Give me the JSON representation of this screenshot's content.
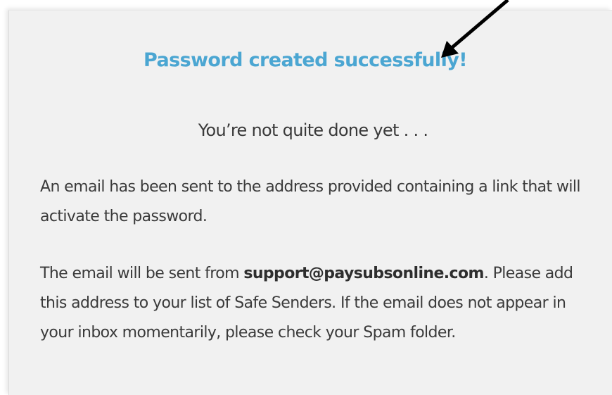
{
  "confirmation": {
    "title": "Password created successfully!",
    "subtitle": "You’re not quite done yet . . .",
    "paragraph1": "An email has been sent to the address provided containing a link that will activate the password.",
    "paragraph2_prefix": "The email will be sent from ",
    "sender_email": "support@paysubsonline.com",
    "paragraph2_suffix": ". Please add this address to your list of Safe Senders. If the email does not appear in your inbox momentarily, please check your Spam folder."
  },
  "colors": {
    "title": "#4ba6d2",
    "panel_background": "#f1f1f1",
    "body_text": "#3a3a3a",
    "annotation_arrow": "#000000"
  },
  "icons": {
    "annotation": "arrow-pointer-icon"
  }
}
